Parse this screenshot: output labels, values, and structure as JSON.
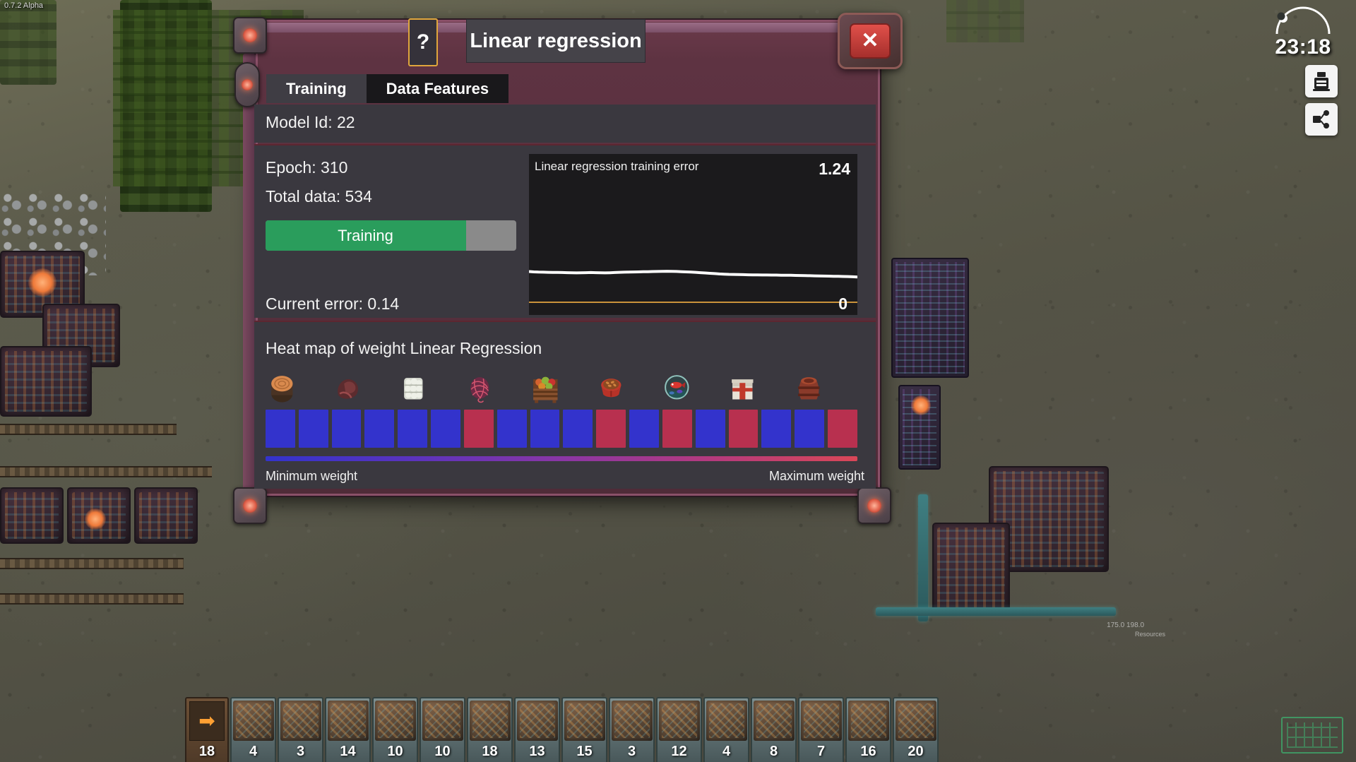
{
  "hud": {
    "version": "0.7.2 Alpha",
    "clock_time": "23:18",
    "research_icon": "research-flask-icon",
    "logistics_icon": "logistics-network-icon",
    "coord_readout": "175.0 198.0",
    "mini_status": "Resources"
  },
  "modal": {
    "title": "Linear regression",
    "help_label": "?",
    "close_label": "✕",
    "tabs": [
      {
        "label": "Training",
        "active": false
      },
      {
        "label": "Data Features",
        "active": true
      }
    ],
    "model_id_label": "Model Id: 22",
    "epoch_label": "Epoch: 310",
    "total_data_label": "Total data: 534",
    "progress": {
      "label": "Training",
      "percent": 80,
      "fill_color": "#2a9d5c",
      "track_color": "#8a8a8a"
    },
    "current_error_label": "Current error: 0.14",
    "heatmap": {
      "title": "Heat map of weight Linear Regression",
      "min_label": "Minimum weight",
      "max_label": "Maximum weight",
      "gradient_start": "#3333cc",
      "gradient_end": "#d94757",
      "icons": [
        "wood-log-icon",
        "raw-meat-icon",
        "cotton-bale-icon",
        "red-yarn-icon",
        "fruit-crate-icon",
        "pet-food-bowl-icon",
        "fish-bowl-icon",
        "gift-box-icon",
        "barrel-icon"
      ],
      "bar_colors": [
        "#3333cc",
        "#3333cc",
        "#3333cc",
        "#3333cc",
        "#3333cc",
        "#3333cc",
        "#b8304f",
        "#3333cc",
        "#3333cc",
        "#3333cc",
        "#b8304f",
        "#3333cc",
        "#b8304f",
        "#3333cc",
        "#b8304f",
        "#3333cc",
        "#3333cc",
        "#b8304f"
      ]
    }
  },
  "chart_data": {
    "type": "line",
    "title": "Linear regression training error",
    "ylabel": "",
    "xlabel": "",
    "ylim": [
      0,
      1.24
    ],
    "max_label": "1.24",
    "min_label": "0",
    "grid": false,
    "legend": "none",
    "line_color": "#ffffff",
    "baseline_color": "#c9923a",
    "series": [
      {
        "name": "training error",
        "values": [
          0.255,
          0.252,
          0.25,
          0.249,
          0.248,
          0.247,
          0.247,
          0.246,
          0.245,
          0.244,
          0.243,
          0.244,
          0.245,
          0.246,
          0.245,
          0.244,
          0.243,
          0.244,
          0.246,
          0.248,
          0.249,
          0.25,
          0.251,
          0.252,
          0.253,
          0.254,
          0.255,
          0.256,
          0.257,
          0.258,
          0.257,
          0.256,
          0.254,
          0.252,
          0.25,
          0.248,
          0.245,
          0.242,
          0.239,
          0.236,
          0.233,
          0.231,
          0.229,
          0.228,
          0.227,
          0.226,
          0.225,
          0.224,
          0.224,
          0.223,
          0.223,
          0.222,
          0.222,
          0.221,
          0.221,
          0.22,
          0.219,
          0.218,
          0.217,
          0.216,
          0.215,
          0.214,
          0.213,
          0.212,
          0.211,
          0.21,
          0.209,
          0.208,
          0.206,
          0.204
        ]
      }
    ]
  },
  "hotbar": {
    "arrow_icon": "arrow-right-icon",
    "arrow_count": "18",
    "slots": [
      {
        "count": "4",
        "icon": "machine-assembler-icon"
      },
      {
        "count": "3",
        "icon": "conveyor-belt-icon"
      },
      {
        "count": "14",
        "icon": "miner-drill-icon"
      },
      {
        "count": "10",
        "icon": "crate-stack-icon"
      },
      {
        "count": "10",
        "icon": "fruit-machine-icon"
      },
      {
        "count": "18",
        "icon": "vehicle-icon"
      },
      {
        "count": "13",
        "icon": "robot-arm-icon"
      },
      {
        "count": "15",
        "icon": "tank-icon"
      },
      {
        "count": "3",
        "icon": "press-icon"
      },
      {
        "count": "12",
        "icon": "lab-icon"
      },
      {
        "count": "4",
        "icon": "smart-cat-store-icon"
      },
      {
        "count": "8",
        "icon": "power-node-icon"
      },
      {
        "count": "7",
        "icon": "printer-icon"
      },
      {
        "count": "16",
        "icon": "shelf-icon"
      },
      {
        "count": "20",
        "icon": "furnace-icon"
      }
    ]
  }
}
